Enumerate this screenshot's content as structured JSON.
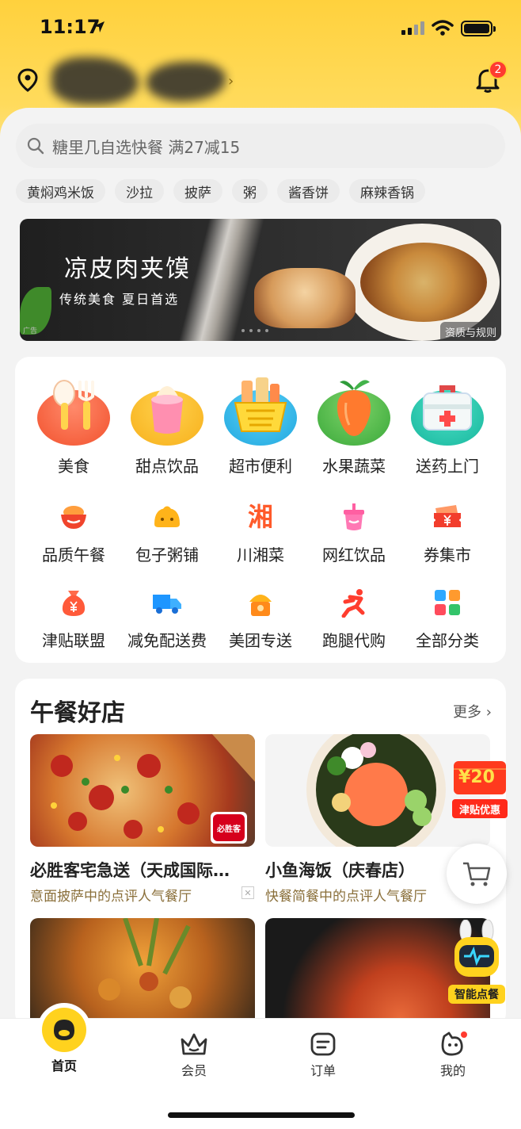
{
  "status_bar": {
    "time": "11:17"
  },
  "header": {
    "notification_count": "2"
  },
  "search": {
    "placeholder": "糖里几自选快餐 满27减15"
  },
  "hot_tags": [
    "黄焖鸡米饭",
    "沙拉",
    "披萨",
    "粥",
    "酱香饼",
    "麻辣香锅"
  ],
  "banner": {
    "title": "凉皮肉夹馍",
    "subtitle": "传统美食  夏日首选",
    "ad_tag": "广告",
    "rule_label": "资质与规则"
  },
  "categories_main": [
    {
      "label": "美食",
      "icon": "cutlery-icon"
    },
    {
      "label": "甜点饮品",
      "icon": "ice-cream-icon"
    },
    {
      "label": "超市便利",
      "icon": "basket-icon"
    },
    {
      "label": "水果蔬菜",
      "icon": "fruit-icon"
    },
    {
      "label": "送药上门",
      "icon": "medicine-kit-icon"
    }
  ],
  "categories_row2": [
    {
      "label": "品质午餐",
      "icon": "rice-bowl-icon"
    },
    {
      "label": "包子粥铺",
      "icon": "bun-icon"
    },
    {
      "label": "川湘菜",
      "icon": "xiang-char-icon",
      "glyph": "湘"
    },
    {
      "label": "网红饮品",
      "icon": "drink-cup-icon"
    },
    {
      "label": "券集市",
      "icon": "coupon-icon"
    }
  ],
  "categories_row3": [
    {
      "label": "津贴联盟",
      "icon": "money-bag-icon"
    },
    {
      "label": "减免配送费",
      "icon": "truck-icon"
    },
    {
      "label": "美团专送",
      "icon": "rider-icon"
    },
    {
      "label": "跑腿代购",
      "icon": "runner-icon"
    },
    {
      "label": "全部分类",
      "icon": "grid-icon"
    }
  ],
  "lunch": {
    "title": "午餐好店",
    "more": "更多",
    "shops": [
      {
        "name": "必胜客宅急送（天成国际…",
        "desc": "意面披萨中的点评人气餐厅",
        "logo_text": "必胜客"
      },
      {
        "name": "小鱼海饭（庆春店）",
        "desc": "快餐简餐中的点评人气餐厅"
      }
    ]
  },
  "promo": {
    "amount": "20",
    "label": "津贴优惠"
  },
  "robot": {
    "label": "智能点餐"
  },
  "tabs": [
    {
      "label": "首页",
      "icon": "home-face-icon"
    },
    {
      "label": "会员",
      "icon": "crown-icon"
    },
    {
      "label": "订单",
      "icon": "order-icon"
    },
    {
      "label": "我的",
      "icon": "profile-icon"
    }
  ],
  "colors": {
    "brand_yellow": "#ffd13d",
    "badge_red": "#ff3b30",
    "desc_brown": "#8a6f3a"
  }
}
